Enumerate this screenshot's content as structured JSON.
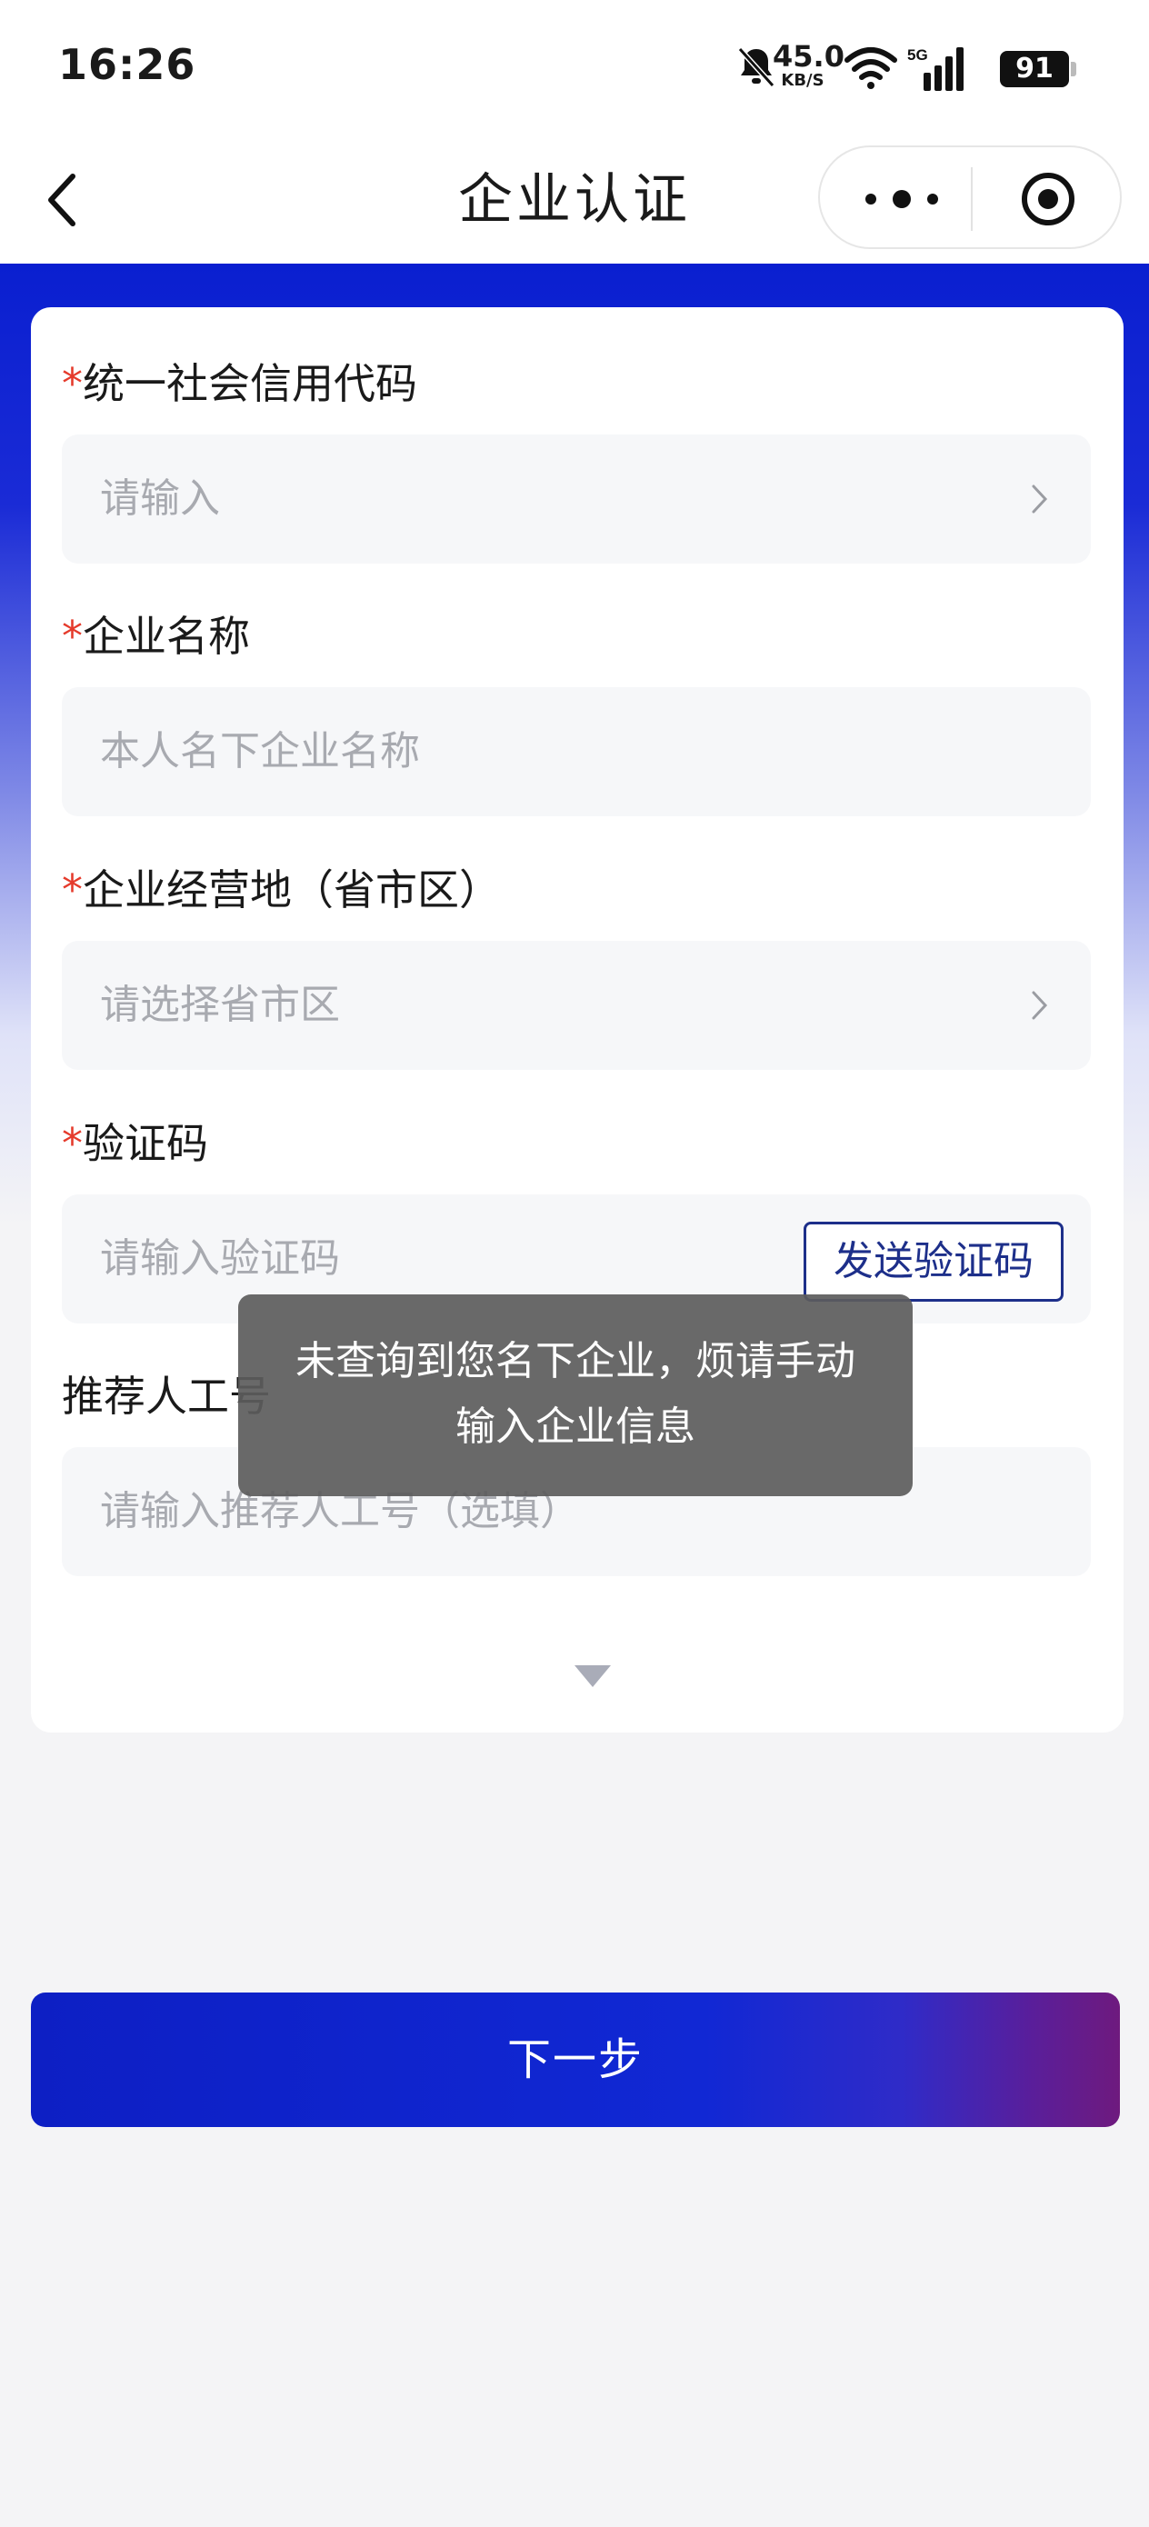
{
  "status_bar": {
    "time": "16:26",
    "net_speed": "45.0",
    "net_unit": "KB/S",
    "network_type": "5G",
    "battery": "91"
  },
  "nav": {
    "title": "企业认证"
  },
  "form": {
    "required_mark": "*",
    "fields": [
      {
        "label": "统一社会信用代码",
        "placeholder": "请输入",
        "required": true,
        "has_chevron": true
      },
      {
        "label": "企业名称",
        "placeholder": "本人名下企业名称",
        "required": true,
        "has_chevron": false
      },
      {
        "label": "企业经营地（省市区）",
        "placeholder": "请选择省市区",
        "required": true,
        "has_chevron": true
      },
      {
        "label": "验证码",
        "placeholder": "请输入验证码",
        "required": true,
        "has_chevron": false
      },
      {
        "label": "推荐人工号",
        "placeholder": "请输入推荐人工号（选填）",
        "required": false,
        "has_chevron": false
      }
    ],
    "send_code_label": "发送验证码"
  },
  "toast": {
    "line1": "未查询到您名下企业，烦请手动",
    "line2": "输入企业信息"
  },
  "next_button_label": "下一步",
  "colors": {
    "primary": "#0d1fc4",
    "required": "#e53b2c",
    "placeholder": "#a8aab0",
    "accent_end": "#6e1a7e"
  }
}
